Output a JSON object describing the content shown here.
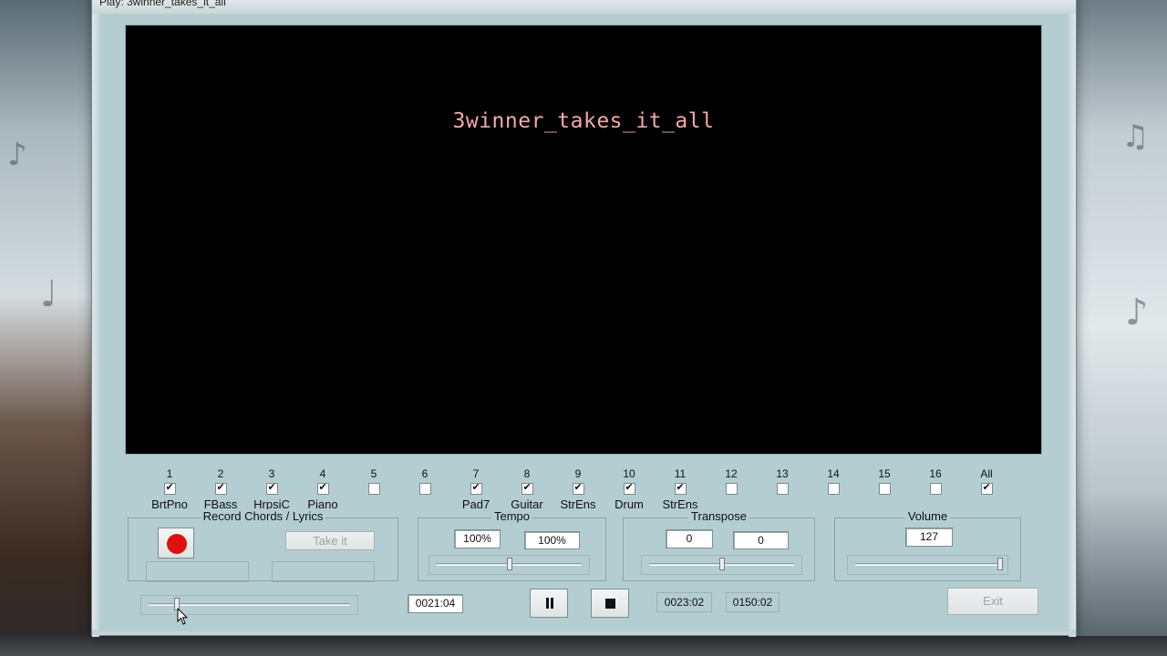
{
  "window": {
    "title": "Play: 3winner_takes_it_all"
  },
  "display": {
    "song_title": "3winner_takes_it_all"
  },
  "channels": [
    {
      "num": "1",
      "name": "BrtPno",
      "checked": true
    },
    {
      "num": "2",
      "name": "FBass",
      "checked": true
    },
    {
      "num": "3",
      "name": "HrpsiC",
      "checked": true
    },
    {
      "num": "4",
      "name": "Piano",
      "checked": true
    },
    {
      "num": "5",
      "name": "",
      "checked": false
    },
    {
      "num": "6",
      "name": "",
      "checked": false
    },
    {
      "num": "7",
      "name": "Pad7",
      "checked": true
    },
    {
      "num": "8",
      "name": "Guitar",
      "checked": true
    },
    {
      "num": "9",
      "name": "StrEns",
      "checked": true
    },
    {
      "num": "10",
      "name": "Drum",
      "checked": true
    },
    {
      "num": "11",
      "name": "StrEns",
      "checked": true
    },
    {
      "num": "12",
      "name": "",
      "checked": false
    },
    {
      "num": "13",
      "name": "",
      "checked": false
    },
    {
      "num": "14",
      "name": "",
      "checked": false
    },
    {
      "num": "15",
      "name": "",
      "checked": false
    },
    {
      "num": "16",
      "name": "",
      "checked": false
    },
    {
      "num": "All",
      "name": "",
      "checked": true
    }
  ],
  "record": {
    "label": "Record Chords / Lyrics",
    "take_it_label": "Take it",
    "field1_value": "",
    "field2_value": ""
  },
  "tempo": {
    "label": "Tempo",
    "value1": "100%",
    "value2": "100%",
    "slider_level": 0.5
  },
  "transpose": {
    "label": "Transpose",
    "value1": "0",
    "value2": "0",
    "slider_level": 0.5
  },
  "volume": {
    "label": "Volume",
    "value": "127",
    "slider_level": 1.0
  },
  "transport": {
    "position_slider_level": 0.14,
    "current_time": "0021:04",
    "pause_icon": "pause-icon",
    "stop_icon": "stop-icon",
    "time_a": "0023:02",
    "time_b": "0150:02",
    "exit_label": "Exit"
  },
  "colors": {
    "window_bg": "#b4cdd0",
    "display_bg": "#000000",
    "title_color": "#f5a9a9",
    "record_red": "#e01010"
  }
}
